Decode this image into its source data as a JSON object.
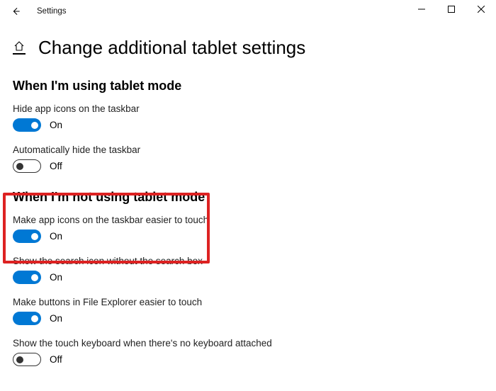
{
  "titlebar": {
    "app_title": "Settings"
  },
  "page_title": "Change additional tablet settings",
  "sections": {
    "using": {
      "heading": "When I'm using tablet mode",
      "hide_icons": {
        "label": "Hide app icons on the taskbar",
        "state": "On"
      },
      "auto_hide": {
        "label": "Automatically hide the taskbar",
        "state": "Off"
      }
    },
    "not_using": {
      "heading": "When I'm not using tablet mode",
      "easier_icons": {
        "label": "Make app icons on the taskbar easier to touch",
        "state": "On"
      },
      "search_icon": {
        "label": "Show the search icon without the search box",
        "state": "On"
      },
      "easier_buttons": {
        "label": "Make buttons in File Explorer easier to touch",
        "state": "On"
      },
      "touch_kb": {
        "label": "Show the touch keyboard when there's no keyboard attached",
        "state": "Off"
      }
    }
  }
}
